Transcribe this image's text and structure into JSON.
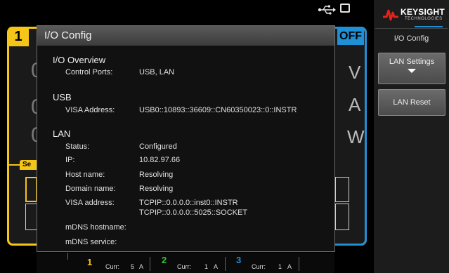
{
  "status_bar": {
    "icons": [
      "usb-icon",
      "lan-icon"
    ]
  },
  "channel": {
    "number": "1",
    "output_state": "OFF",
    "digits": [
      "0",
      "0",
      "0"
    ],
    "units": [
      "V",
      "A",
      "W"
    ],
    "tab_label": "Se"
  },
  "dialog": {
    "title": "I/O Config",
    "overview": {
      "heading": "I/O Overview",
      "control_ports_label": "Control Ports:",
      "control_ports_value": "USB, LAN"
    },
    "usb": {
      "heading": "USB",
      "visa_label": "VISA Address:",
      "visa_value": "USB0::10893::36609::CN60350023::0::INSTR"
    },
    "lan": {
      "heading": "LAN",
      "rows": [
        {
          "label": "Status:",
          "value": "Configured"
        },
        {
          "label": "IP:",
          "value": "10.82.97.66"
        },
        {
          "label": "Host name:",
          "value": "Resolving"
        },
        {
          "label": "Domain name:",
          "value": "Resolving"
        },
        {
          "label": "VISA address:",
          "value": "TCPIP::0.0.0.0::inst0::INSTR",
          "value2": "TCPIP::0.0.0.0::5025::SOCKET"
        },
        {
          "label": "mDNS hostname:",
          "value": ""
        },
        {
          "label": "mDNS service:",
          "value": ""
        }
      ]
    }
  },
  "softkeys": {
    "brand": "KEYSIGHT",
    "brand_sub": "TECHNOLOGIES",
    "menu_title": "I/O Config",
    "lan_settings": "LAN Settings",
    "lan_reset": "LAN Reset"
  },
  "bottom_bar": {
    "channels": [
      {
        "num": "1",
        "label": "Curr:",
        "value": "5",
        "unit": "A",
        "color": "#f5c518"
      },
      {
        "num": "2",
        "label": "Curr:",
        "value": "1",
        "unit": "A",
        "color": "#39c23a"
      },
      {
        "num": "3",
        "label": "Curr:",
        "value": "1",
        "unit": "A",
        "color": "#1f8fd6"
      }
    ]
  },
  "colors": {
    "channel1": "#f5c518",
    "channel2": "#39c23a",
    "channel3": "#1f8fd6"
  }
}
